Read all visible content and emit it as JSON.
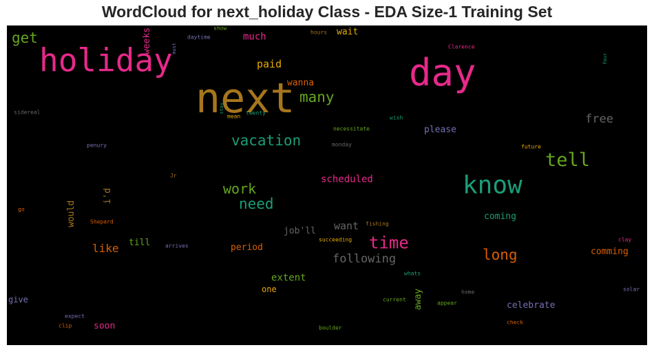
{
  "chart_data": {
    "type": "wordcloud",
    "title": "WordCloud for next_holiday Class - EDA Size-1 Training Set",
    "background": "#000000",
    "words": [
      {
        "text": "next",
        "size": 60,
        "color": "#A6761D",
        "vertical": false
      },
      {
        "text": "holiday",
        "size": 46,
        "color": "#E7298A",
        "vertical": false
      },
      {
        "text": "day",
        "size": 54,
        "color": "#E7298A",
        "vertical": false
      },
      {
        "text": "know",
        "size": 36,
        "color": "#1B9E77",
        "vertical": false
      },
      {
        "text": "tell",
        "size": 27,
        "color": "#66A61E",
        "vertical": false
      },
      {
        "text": "time",
        "size": 24,
        "color": "#E7298A",
        "vertical": false
      },
      {
        "text": "vacation",
        "size": 21,
        "color": "#1B9E77",
        "vertical": false
      },
      {
        "text": "many",
        "size": 21,
        "color": "#66A61E",
        "vertical": false
      },
      {
        "text": "need",
        "size": 21,
        "color": "#1B9E77",
        "vertical": false
      },
      {
        "text": "work",
        "size": 20,
        "color": "#66A61E",
        "vertical": false
      },
      {
        "text": "get",
        "size": 21,
        "color": "#66A61E",
        "vertical": false
      },
      {
        "text": "long",
        "size": 21,
        "color": "#D95F02",
        "vertical": false
      },
      {
        "text": "free",
        "size": 17,
        "color": "#666666",
        "vertical": false
      },
      {
        "text": "following",
        "size": 17,
        "color": "#666666",
        "vertical": false
      },
      {
        "text": "want",
        "size": 15,
        "color": "#666666",
        "vertical": false
      },
      {
        "text": "like",
        "size": 16,
        "color": "#D95F02",
        "vertical": false
      },
      {
        "text": "paid",
        "size": 15,
        "color": "#E6AB02",
        "vertical": false
      },
      {
        "text": "much",
        "size": 14,
        "color": "#E7298A",
        "vertical": false
      },
      {
        "text": "extent",
        "size": 14,
        "color": "#66A61E",
        "vertical": false
      },
      {
        "text": "scheduled",
        "size": 14,
        "color": "#E7298A",
        "vertical": false
      },
      {
        "text": "wanna",
        "size": 13,
        "color": "#D95F02",
        "vertical": false
      },
      {
        "text": "wait",
        "size": 13,
        "color": "#E6AB02",
        "vertical": false
      },
      {
        "text": "till",
        "size": 13,
        "color": "#66A61E",
        "vertical": false
      },
      {
        "text": "period",
        "size": 13,
        "color": "#D95F02",
        "vertical": false
      },
      {
        "text": "job'll",
        "size": 13,
        "color": "#666666",
        "vertical": false
      },
      {
        "text": "please",
        "size": 13,
        "color": "#7570B3",
        "vertical": false
      },
      {
        "text": "coming",
        "size": 13,
        "color": "#1B9E77",
        "vertical": false
      },
      {
        "text": "comming",
        "size": 13,
        "color": "#D95F02",
        "vertical": false
      },
      {
        "text": "celebrate",
        "size": 13,
        "color": "#7570B3",
        "vertical": false
      },
      {
        "text": "soon",
        "size": 13,
        "color": "#E7298A",
        "vertical": false
      },
      {
        "text": "give",
        "size": 12,
        "color": "#7570B3",
        "vertical": false
      },
      {
        "text": "one",
        "size": 12,
        "color": "#E6AB02",
        "vertical": false
      },
      {
        "text": "weeks",
        "size": 13,
        "color": "#E7298A",
        "vertical": true
      },
      {
        "text": "i'd",
        "size": 13,
        "color": "#A6761D",
        "vertical": true
      },
      {
        "text": "would",
        "size": 13,
        "color": "#A6761D",
        "vertical": true
      },
      {
        "text": "away",
        "size": 13,
        "color": "#66A61E",
        "vertical": true
      },
      {
        "text": "sidereal",
        "size": 8,
        "color": "#666666",
        "vertical": false
      },
      {
        "text": "daytime",
        "size": 8,
        "color": "#7570B3",
        "vertical": false
      },
      {
        "text": "show",
        "size": 8,
        "color": "#66A61E",
        "vertical": false
      },
      {
        "text": "must",
        "size": 7,
        "color": "#7570B3",
        "vertical": true
      },
      {
        "text": "hours",
        "size": 8,
        "color": "#A6761D",
        "vertical": false
      },
      {
        "text": "Clarence",
        "size": 8,
        "color": "#E7298A",
        "vertical": false
      },
      {
        "text": "four",
        "size": 7,
        "color": "#1B9E77",
        "vertical": true
      },
      {
        "text": "stay",
        "size": 7,
        "color": "#1B9E77",
        "vertical": true
      },
      {
        "text": "mean",
        "size": 8,
        "color": "#E6AB02",
        "vertical": false
      },
      {
        "text": "twenty",
        "size": 8,
        "color": "#1B9E77",
        "vertical": false
      },
      {
        "text": "wish",
        "size": 8,
        "color": "#1B9E77",
        "vertical": false
      },
      {
        "text": "necessitate",
        "size": 8,
        "color": "#66A61E",
        "vertical": false
      },
      {
        "text": "monday",
        "size": 8,
        "color": "#666666",
        "vertical": false
      },
      {
        "text": "penury",
        "size": 8,
        "color": "#7570B3",
        "vertical": false
      },
      {
        "text": "future",
        "size": 8,
        "color": "#E6AB02",
        "vertical": false
      },
      {
        "text": "Jr",
        "size": 8,
        "color": "#A6761D",
        "vertical": false
      },
      {
        "text": "go",
        "size": 8,
        "color": "#D95F02",
        "vertical": false
      },
      {
        "text": "Shepard",
        "size": 8,
        "color": "#D95F02",
        "vertical": false
      },
      {
        "text": "fishing",
        "size": 8,
        "color": "#A6761D",
        "vertical": false
      },
      {
        "text": "succeeding",
        "size": 8,
        "color": "#E6AB02",
        "vertical": false
      },
      {
        "text": "arrives",
        "size": 8,
        "color": "#7570B3",
        "vertical": false
      },
      {
        "text": "clay",
        "size": 8,
        "color": "#E7298A",
        "vertical": false
      },
      {
        "text": "whats",
        "size": 8,
        "color": "#1B9E77",
        "vertical": false
      },
      {
        "text": "home",
        "size": 8,
        "color": "#666666",
        "vertical": false
      },
      {
        "text": "solar",
        "size": 8,
        "color": "#7570B3",
        "vertical": false
      },
      {
        "text": "current",
        "size": 8,
        "color": "#66A61E",
        "vertical": false
      },
      {
        "text": "appear",
        "size": 8,
        "color": "#66A61E",
        "vertical": false
      },
      {
        "text": "expect",
        "size": 8,
        "color": "#7570B3",
        "vertical": false
      },
      {
        "text": "clip",
        "size": 8,
        "color": "#D95F02",
        "vertical": false
      },
      {
        "text": "check",
        "size": 8,
        "color": "#D95F02",
        "vertical": false
      },
      {
        "text": "boulder",
        "size": 8,
        "color": "#66A61E",
        "vertical": false
      }
    ]
  }
}
